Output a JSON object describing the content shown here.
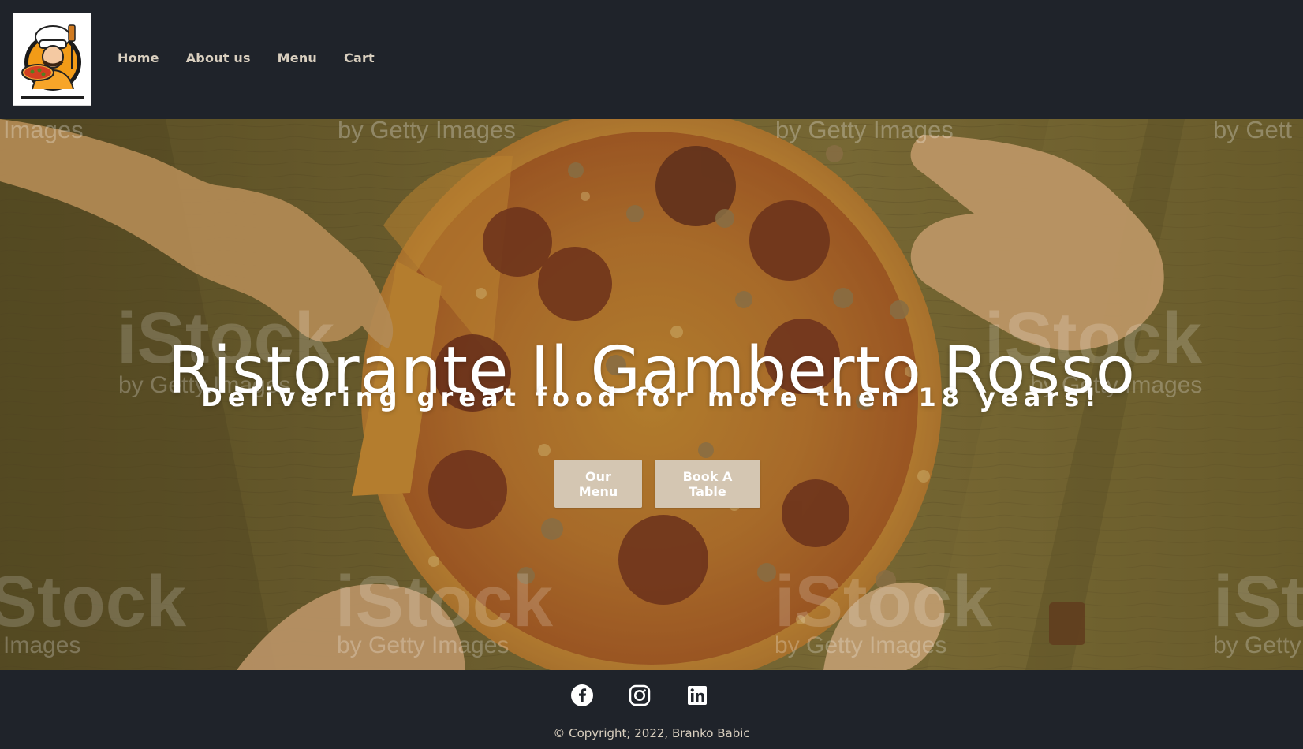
{
  "colors": {
    "nav_bg": "#1f232a",
    "nav_text": "#d9cfbf",
    "hero_overlay": "#7a6b38",
    "button_bg": "#d4c6b2",
    "white": "#ffffff"
  },
  "header": {
    "logo_icon": "chef-pizza-logo-icon",
    "nav": [
      {
        "label": "Home"
      },
      {
        "label": "About us"
      },
      {
        "label": "Menu"
      },
      {
        "label": "Cart"
      }
    ]
  },
  "hero": {
    "title": "Ristorante Il Gamberto Rosso",
    "subtitle": "Delivering great food for more then 18 years!",
    "buttons": {
      "menu": "Our Menu",
      "book": "Book A Table"
    },
    "watermarks": [
      "iStock",
      "by Getty Images",
      "iStock",
      "by Getty Images",
      "iStock",
      "by Getty Images",
      "iStock",
      "by Getty Images",
      "Images",
      "by Getty",
      "Images",
      "by Gett"
    ]
  },
  "footer": {
    "social": [
      {
        "icon": "facebook-icon"
      },
      {
        "icon": "instagram-icon"
      },
      {
        "icon": "linkedin-icon"
      }
    ],
    "copyright": "© Copyright; 2022, Branko Babic"
  }
}
